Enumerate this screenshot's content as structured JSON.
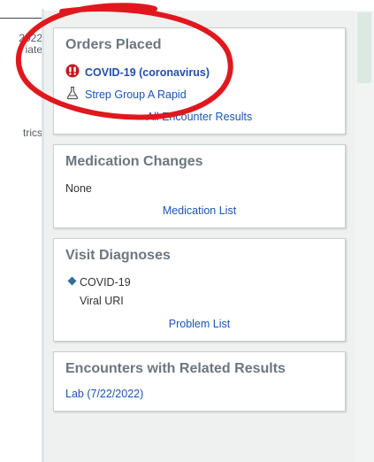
{
  "left_pane": {
    "line1": "2022",
    "line2": "iate",
    "line3": "trics"
  },
  "cards": {
    "orders": {
      "title": "Orders Placed",
      "item1": "COVID-19 (coronavirus)",
      "item2": "Strep Group A Rapid",
      "footer_link": "All Encounter Results"
    },
    "medication": {
      "title": "Medication Changes",
      "none_text": "None",
      "footer_link": "Medication List"
    },
    "diagnoses": {
      "title": "Visit Diagnoses",
      "item1": "COVID-19",
      "item2": "Viral URI",
      "footer_link": "Problem List"
    },
    "encounters": {
      "title": "Encounters with Related Results",
      "item1": "Lab (7/22/2022)"
    }
  },
  "colors": {
    "card_title": "#6c7680",
    "link": "#1a55b5",
    "annotation": "#e0181e",
    "diamond": "#2f6f9a"
  },
  "icons": {
    "covid_item": "red-alert-icon",
    "strep_item": "flask-icon",
    "diagnosis_primary": "diamond-icon"
  }
}
